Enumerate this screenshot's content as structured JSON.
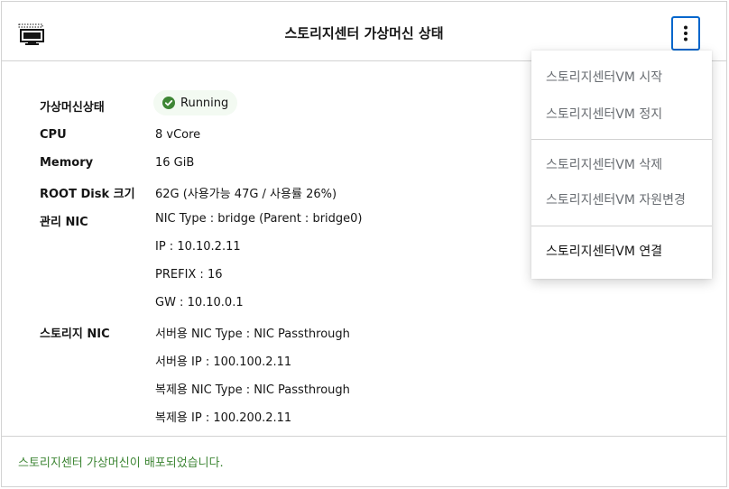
{
  "header": {
    "title": "스토리지센터 가상머신 상태",
    "icon": "monitor-icon",
    "actions_icon": "kebab-icon"
  },
  "details": {
    "vm_state_label": "가상머신상태",
    "vm_state_value": "Running",
    "vm_state_color": "#3e8635",
    "cpu_label": "CPU",
    "cpu_value": "8 vCore",
    "memory_label": "Memory",
    "memory_value": "16 GiB",
    "root_disk_label": "ROOT Disk 크기",
    "root_disk_value": "62G (사용가능 47G / 사용률 26%)",
    "mgmt_nic_label": "관리 NIC",
    "mgmt_nic_type": "NIC Type : bridge (Parent : bridge0)",
    "mgmt_nic_ip": "IP : 10.10.2.11",
    "mgmt_nic_prefix": "PREFIX : 16",
    "mgmt_nic_gw": "GW : 10.10.0.1",
    "storage_nic_label": "스토리지 NIC",
    "storage_nic_server_type": "서버용 NIC Type : NIC Passthrough",
    "storage_nic_server_ip": "서버용 IP : 100.100.2.11",
    "storage_nic_repl_type": "복제용 NIC Type : NIC Passthrough",
    "storage_nic_repl_ip": "복제용 IP : 100.200.2.11"
  },
  "footer": {
    "message": "스토리지센터 가상머신이 배포되었습니다.",
    "message_color": "#3e8635"
  },
  "menu": {
    "start": "스토리지센터VM 시작",
    "stop": "스토리지센터VM 정지",
    "delete": "스토리지센터VM 삭제",
    "resize": "스토리지센터VM 자원변경",
    "connect": "스토리지센터VM 연결"
  }
}
